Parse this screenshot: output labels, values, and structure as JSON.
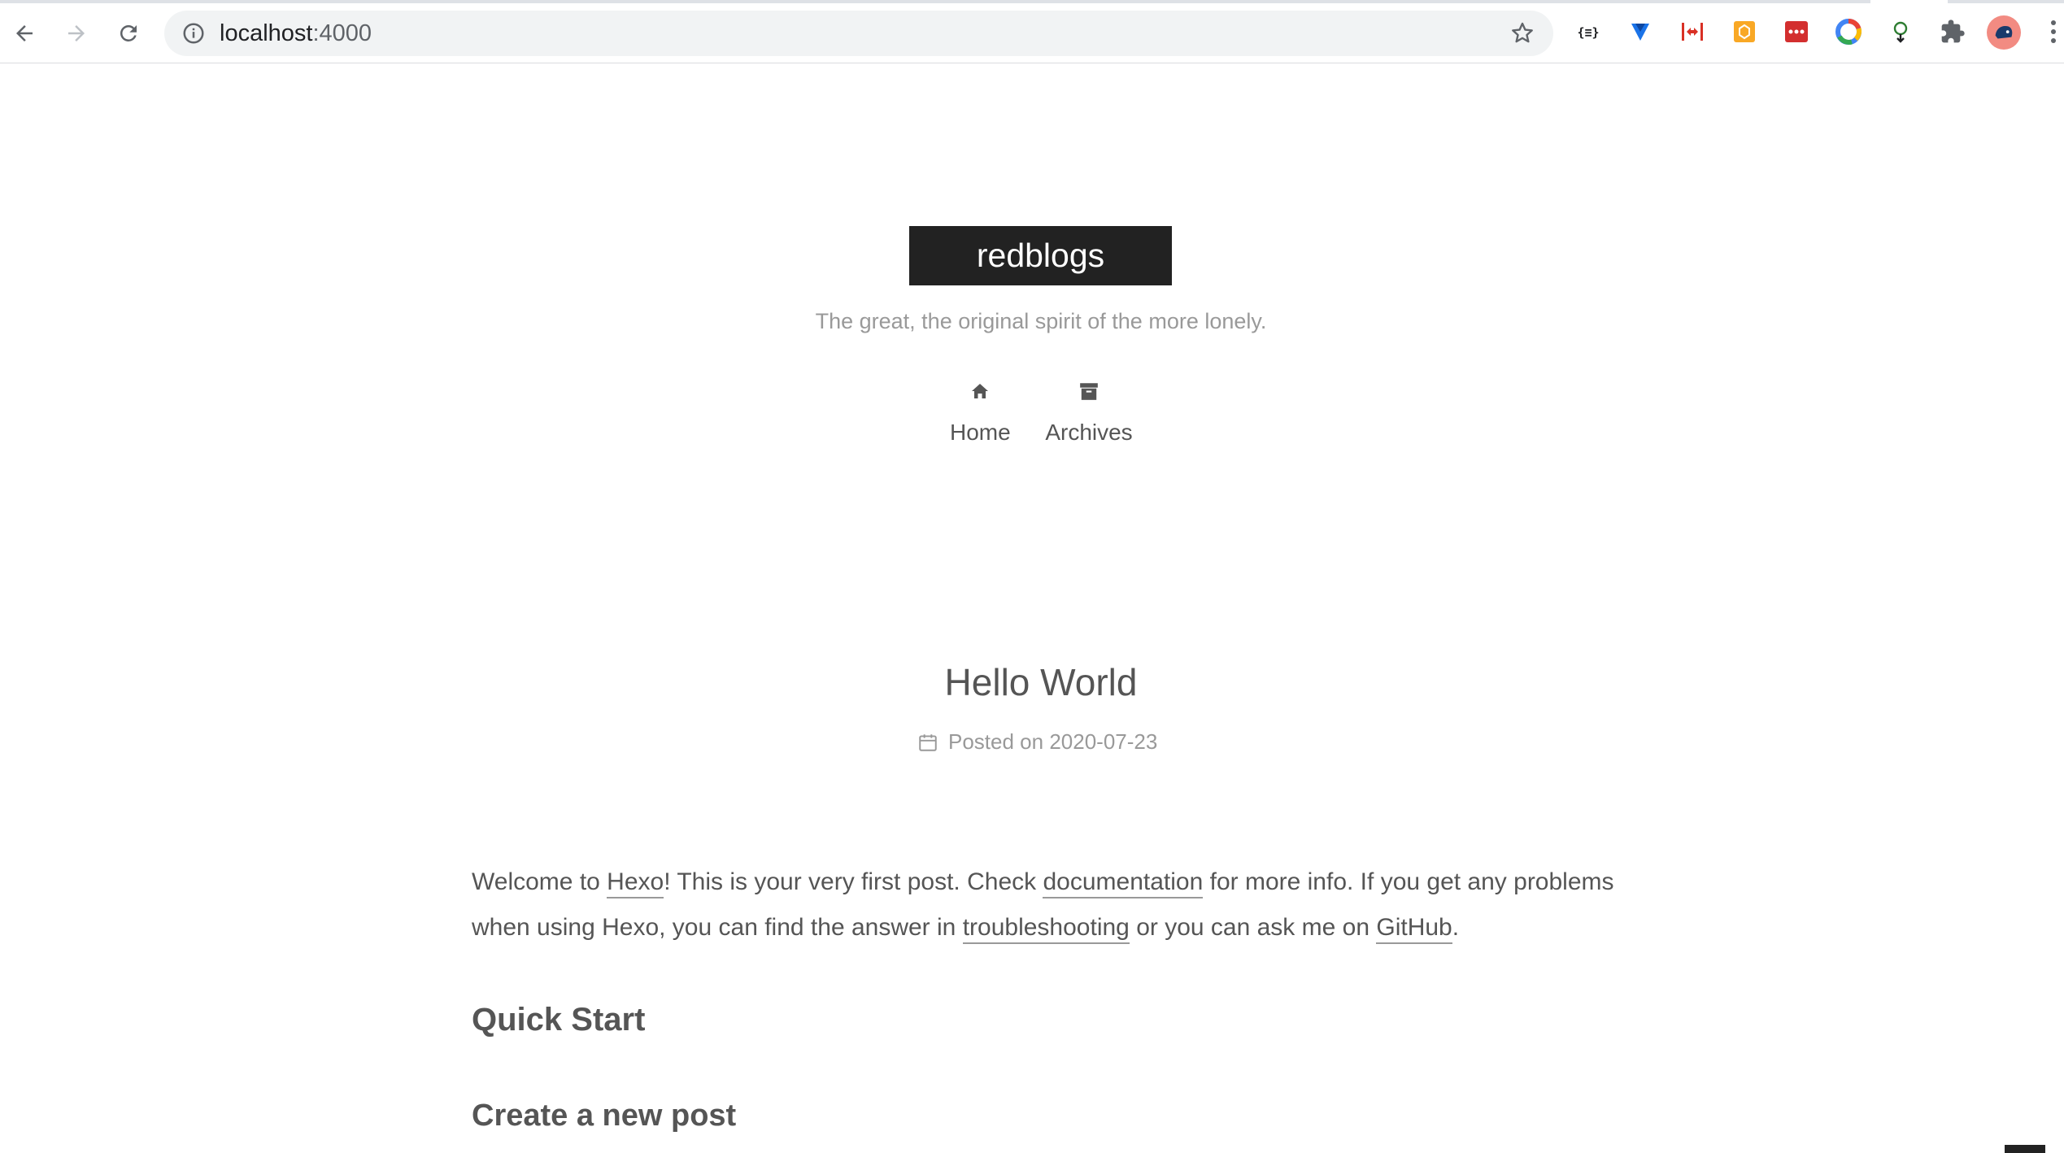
{
  "browser": {
    "url_host": "localhost",
    "url_port": ":4000"
  },
  "site": {
    "brand": "redblogs",
    "subtitle": "The great, the original spirit of the more lonely.",
    "menu": [
      {
        "label": "Home",
        "icon": "home-icon"
      },
      {
        "label": "Archives",
        "icon": "archive-icon"
      }
    ]
  },
  "post": {
    "title": "Hello World",
    "meta_prefix": "Posted on",
    "date": "2020-07-23",
    "para": {
      "t1": "Welcome to ",
      "link_hexo": "Hexo",
      "t2": "! This is your very first post. Check ",
      "link_docs": "documentation",
      "t3": " for more info. If you get any problems when using Hexo, you can find the answer in ",
      "link_troubleshooting": "troubleshooting",
      "t4": " or you can ask me on ",
      "link_github": "GitHub",
      "t5": "."
    },
    "heading_quick_start": "Quick Start",
    "heading_create_post": "Create a new post"
  }
}
